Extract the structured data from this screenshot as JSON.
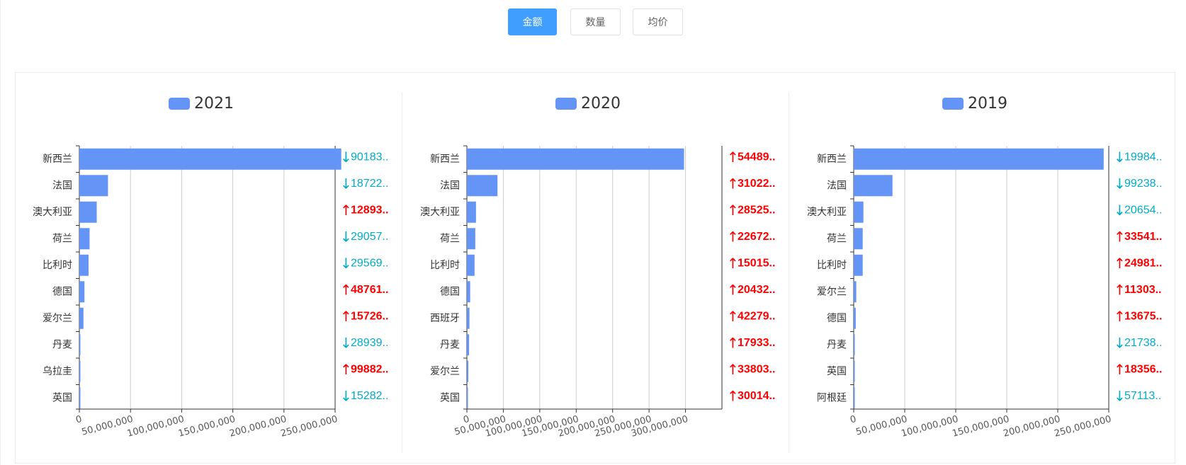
{
  "tabs": [
    {
      "label": "金额",
      "active": true
    },
    {
      "label": "数量",
      "active": false
    },
    {
      "label": "均价",
      "active": false
    }
  ],
  "colors": {
    "bar": "#6495f6",
    "up": "#ff0000",
    "down": "#00acc9",
    "active_tab": "#409eff"
  },
  "chart_data": [
    {
      "type": "bar",
      "orientation": "horizontal",
      "legend": "2021",
      "categories": [
        "新西兰",
        "法国",
        "澳大利亚",
        "荷兰",
        "比利时",
        "德国",
        "爱尔兰",
        "丹麦",
        "乌拉圭",
        "英国"
      ],
      "values": [
        256000000,
        28000000,
        17000000,
        10000000,
        9000000,
        5000000,
        4000000,
        500000,
        300000,
        200000
      ],
      "xlim": [
        0,
        250000000
      ],
      "xticks": [
        0,
        50000000,
        100000000,
        150000000,
        200000000,
        250000000
      ],
      "xtick_labels": [
        "0",
        "50,000,000",
        "100,000,000",
        "150,000,000",
        "200,000,000",
        "250,000,000"
      ],
      "annotations": [
        {
          "dir": "down",
          "text": "90183.."
        },
        {
          "dir": "down",
          "text": "18722.."
        },
        {
          "dir": "up",
          "text": "12893.."
        },
        {
          "dir": "down",
          "text": "29057.."
        },
        {
          "dir": "down",
          "text": "29569.."
        },
        {
          "dir": "up",
          "text": "48761.."
        },
        {
          "dir": "up",
          "text": "15726.."
        },
        {
          "dir": "down",
          "text": "28939.."
        },
        {
          "dir": "up",
          "text": "99882.."
        },
        {
          "dir": "down",
          "text": "15282.."
        }
      ]
    },
    {
      "type": "bar",
      "orientation": "horizontal",
      "legend": "2020",
      "categories": [
        "新西兰",
        "法国",
        "澳大利亚",
        "荷兰",
        "比利时",
        "德国",
        "西班牙",
        "丹麦",
        "爱尔兰",
        "英国"
      ],
      "values": [
        298000000,
        42000000,
        12500000,
        11500000,
        10500000,
        4500000,
        3500000,
        3000000,
        2000000,
        1000000
      ],
      "xlim": [
        0,
        350000000
      ],
      "xticks": [
        0,
        50000000,
        100000000,
        150000000,
        200000000,
        250000000,
        300000000
      ],
      "xtick_labels": [
        "0",
        "50,000,000",
        "100,000,000",
        "150,000,000",
        "200,000,000",
        "250,000,000",
        "300,000,000"
      ],
      "annotations": [
        {
          "dir": "up",
          "text": "54489.."
        },
        {
          "dir": "up",
          "text": "31022.."
        },
        {
          "dir": "up",
          "text": "28525.."
        },
        {
          "dir": "up",
          "text": "22672.."
        },
        {
          "dir": "up",
          "text": "15015.."
        },
        {
          "dir": "up",
          "text": "20432.."
        },
        {
          "dir": "up",
          "text": "42279.."
        },
        {
          "dir": "up",
          "text": "17933.."
        },
        {
          "dir": "up",
          "text": "33803.."
        },
        {
          "dir": "up",
          "text": "30014.."
        }
      ]
    },
    {
      "type": "bar",
      "orientation": "horizontal",
      "legend": "2019",
      "categories": [
        "新西兰",
        "法国",
        "澳大利亚",
        "荷兰",
        "比利时",
        "爱尔兰",
        "德国",
        "丹麦",
        "英国",
        "阿根廷"
      ],
      "values": [
        245000000,
        38000000,
        9500000,
        8800000,
        8800000,
        2500000,
        2000000,
        1000000,
        800000,
        500000
      ],
      "xlim": [
        0,
        250000000
      ],
      "xticks": [
        0,
        50000000,
        100000000,
        150000000,
        200000000,
        250000000
      ],
      "xtick_labels": [
        "0",
        "50,000,000",
        "100,000,000",
        "150,000,000",
        "200,000,000",
        "250,000,000"
      ],
      "annotations": [
        {
          "dir": "down",
          "text": "19984.."
        },
        {
          "dir": "down",
          "text": "99238.."
        },
        {
          "dir": "down",
          "text": "20654.."
        },
        {
          "dir": "up",
          "text": "33541.."
        },
        {
          "dir": "up",
          "text": "24981.."
        },
        {
          "dir": "up",
          "text": "11303.."
        },
        {
          "dir": "up",
          "text": "13675.."
        },
        {
          "dir": "down",
          "text": "21738.."
        },
        {
          "dir": "up",
          "text": "18356.."
        },
        {
          "dir": "down",
          "text": "57113.."
        }
      ]
    }
  ]
}
